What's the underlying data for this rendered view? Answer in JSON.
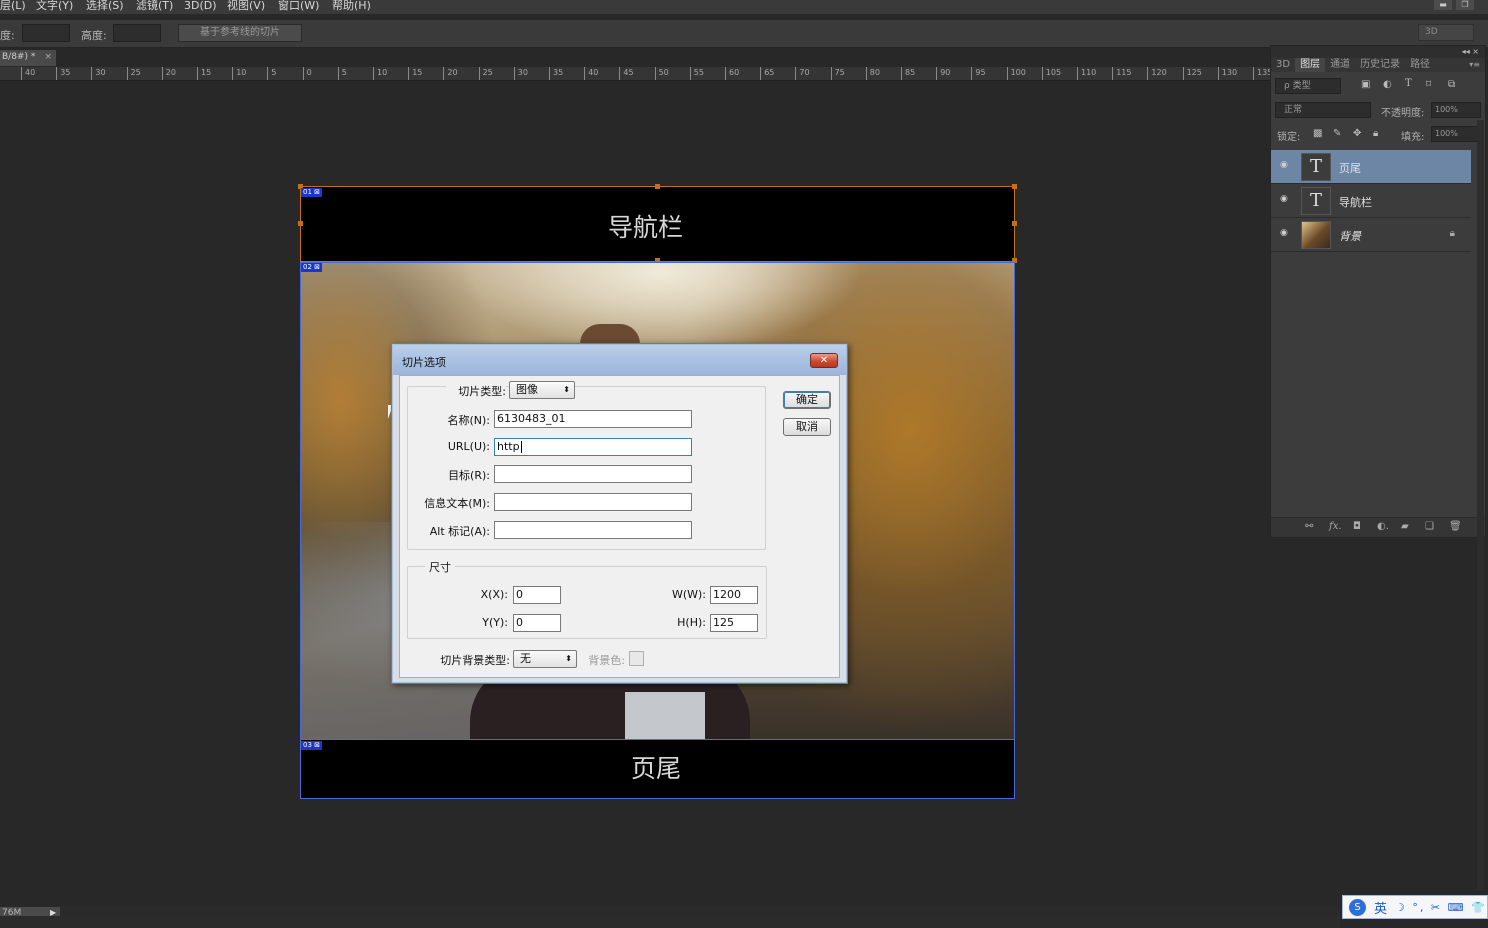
{
  "menu": [
    "层(L)",
    "文字(Y)",
    "选择(S)",
    "滤镜(T)",
    "3D(D)",
    "视图(V)",
    "窗口(W)",
    "帮助(H)"
  ],
  "options_bar": {
    "width_label": "度:",
    "height_label": "高度:",
    "guides_slice_button": "基于参考线的切片",
    "workspace": "3D"
  },
  "doc_tab": {
    "title": "B/8#) *",
    "close": "×"
  },
  "ruler_ticks": [
    "40",
    "35",
    "30",
    "25",
    "20",
    "15",
    "10",
    "5",
    "0",
    "5",
    "10",
    "15",
    "20",
    "25",
    "30",
    "35",
    "40",
    "45",
    "50",
    "55",
    "60",
    "65",
    "70",
    "75",
    "80",
    "85",
    "90",
    "95",
    "100",
    "105",
    "110",
    "115",
    "120",
    "125",
    "130",
    "135"
  ],
  "canvas": {
    "nav_text": "导航栏",
    "footer_text": "页尾"
  },
  "slices": [
    {
      "label": "01",
      "icon": "⊠"
    },
    {
      "label": "02",
      "icon": "⊠"
    },
    {
      "label": "03",
      "icon": "⊠"
    }
  ],
  "layers_panel": {
    "collapse": "◂◂ ×",
    "tabs": [
      "3D",
      "图层",
      "通道",
      "历史记录",
      "路径"
    ],
    "active_tab": "图层",
    "menu_icon": "▾≡",
    "filter_label": "ρ 类型",
    "blend_mode": "正常",
    "opacity_label": "不透明度:",
    "opacity_value": "100%",
    "lock_label": "锁定:",
    "fill_label": "填充:",
    "fill_value": "100%",
    "layers": [
      {
        "name": "页尾",
        "kind": "text",
        "thumb": "T",
        "selected": true
      },
      {
        "name": "导航栏",
        "kind": "text",
        "thumb": "T",
        "selected": false
      },
      {
        "name": "背景",
        "kind": "image",
        "thumb": "",
        "selected": false,
        "locked": true
      }
    ],
    "bottom_icons": [
      "link-icon",
      "fx-icon",
      "mask-icon",
      "adjustment-icon",
      "folder-icon",
      "new-layer-icon",
      "trash-icon"
    ]
  },
  "status_bar": {
    "doc_size": "76M",
    "arrow": "▶"
  },
  "ime": {
    "lang": "英",
    "symbols": "☽ °, ✂ ⌨ 👕"
  },
  "dialog": {
    "title": "切片选项",
    "close": "✕",
    "slice_type_label": "切片类型:",
    "slice_type_value": "图像",
    "name_label": "名称(N):",
    "name_value": "6130483_01",
    "url_label": "URL(U):",
    "url_value": "http",
    "target_label": "目标(R):",
    "target_value": "",
    "message_label": "信息文本(M):",
    "message_value": "",
    "alt_label": "Alt 标记(A):",
    "alt_value": "",
    "dimensions_legend": "尺寸",
    "x_label": "X(X):",
    "x_value": "0",
    "y_label": "Y(Y):",
    "y_value": "0",
    "w_label": "W(W):",
    "w_value": "1200",
    "h_label": "H(H):",
    "h_value": "125",
    "bg_type_label": "切片背景类型:",
    "bg_type_value": "无",
    "bg_color_label": "背景色:",
    "ok_label": "确定",
    "cancel_label": "取消"
  }
}
